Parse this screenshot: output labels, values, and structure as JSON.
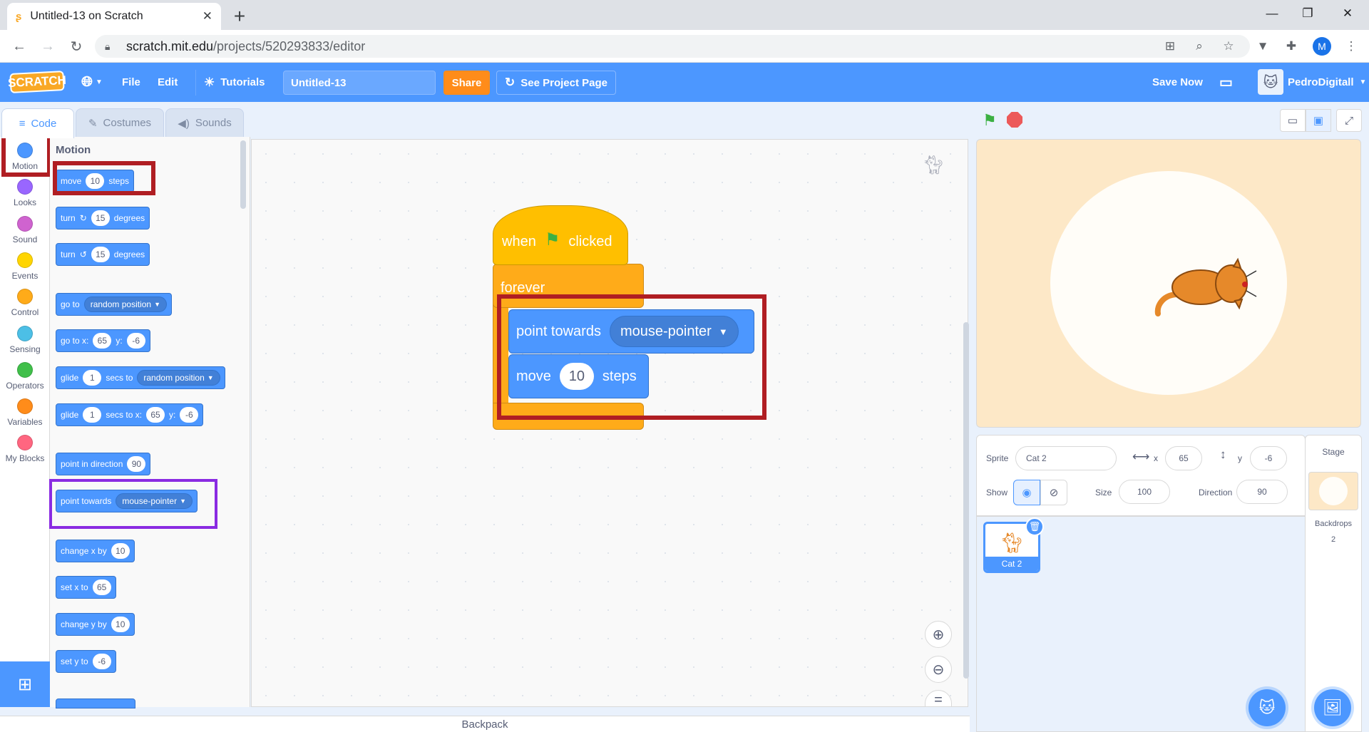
{
  "browser": {
    "tab_title": "Untitled-13 on Scratch",
    "url_host": "scratch.mit.edu",
    "url_path": "/projects/520293833/editor",
    "profile_initial": "M"
  },
  "menubar": {
    "logo_text": "SCRATCH",
    "file_label": "File",
    "edit_label": "Edit",
    "tutorials_label": "Tutorials",
    "project_title": "Untitled-13",
    "share_label": "Share",
    "see_project_label": "See Project Page",
    "save_now_label": "Save Now",
    "username": "PedroDigitall"
  },
  "editor_tabs": {
    "code": "Code",
    "costumes": "Costumes",
    "sounds": "Sounds"
  },
  "categories": [
    {
      "label": "Motion",
      "color": "#4c97ff"
    },
    {
      "label": "Looks",
      "color": "#9966ff"
    },
    {
      "label": "Sound",
      "color": "#cf63cf"
    },
    {
      "label": "Events",
      "color": "#ffd500"
    },
    {
      "label": "Control",
      "color": "#ffab19"
    },
    {
      "label": "Sensing",
      "color": "#4cbfe6"
    },
    {
      "label": "Operators",
      "color": "#40bf4a"
    },
    {
      "label": "Variables",
      "color": "#ff8c1a"
    },
    {
      "label": "My Blocks",
      "color": "#ff6680"
    }
  ],
  "palette": {
    "title": "Motion",
    "move": {
      "a": "move",
      "v": "10",
      "b": "steps"
    },
    "turn_cw": {
      "a": "turn",
      "v": "15",
      "b": "degrees"
    },
    "turn_ccw": {
      "a": "turn",
      "v": "15",
      "b": "degrees"
    },
    "goto": {
      "a": "go to",
      "dd": "random position"
    },
    "goto_xy": {
      "a": "go to x:",
      "x": "65",
      "b": "y:",
      "y": "-6"
    },
    "glide_to": {
      "a": "glide",
      "v": "1",
      "b": "secs to",
      "dd": "random position"
    },
    "glide_xy": {
      "a": "glide",
      "v": "1",
      "b": "secs to x:",
      "x": "65",
      "c": "y:",
      "y": "-6"
    },
    "point_dir": {
      "a": "point in direction",
      "v": "90"
    },
    "point_towards": {
      "a": "point towards",
      "dd": "mouse-pointer"
    },
    "change_x": {
      "a": "change x by",
      "v": "10"
    },
    "set_x": {
      "a": "set x to",
      "v": "65"
    },
    "change_y": {
      "a": "change y by",
      "v": "10"
    },
    "set_y": {
      "a": "set y to",
      "v": "-6"
    }
  },
  "script": {
    "hat_when": "when",
    "hat_clicked": "clicked",
    "forever": "forever",
    "point_towards": "point towards",
    "point_towards_dd": "mouse-pointer",
    "move": "move",
    "move_value": "10",
    "move_steps": "steps"
  },
  "backpack_label": "Backpack",
  "sprite_info": {
    "sprite_label": "Sprite",
    "sprite_name": "Cat 2",
    "x_label": "x",
    "x_value": "65",
    "y_label": "y",
    "y_value": "-6",
    "show_label": "Show",
    "size_label": "Size",
    "size_value": "100",
    "direction_label": "Direction",
    "direction_value": "90"
  },
  "sprites": [
    {
      "name": "Cat 2"
    }
  ],
  "stage_panel": {
    "title": "Stage",
    "backdrops_label": "Backdrops",
    "backdrops_count": "2"
  },
  "colors": {
    "menubar": "#4c97ff",
    "highlight_red": "#b01e23",
    "highlight_purple": "#8a2be2",
    "motion_block": "#4c97ff",
    "events_block": "#ffbf00",
    "control_block": "#ffab19"
  }
}
